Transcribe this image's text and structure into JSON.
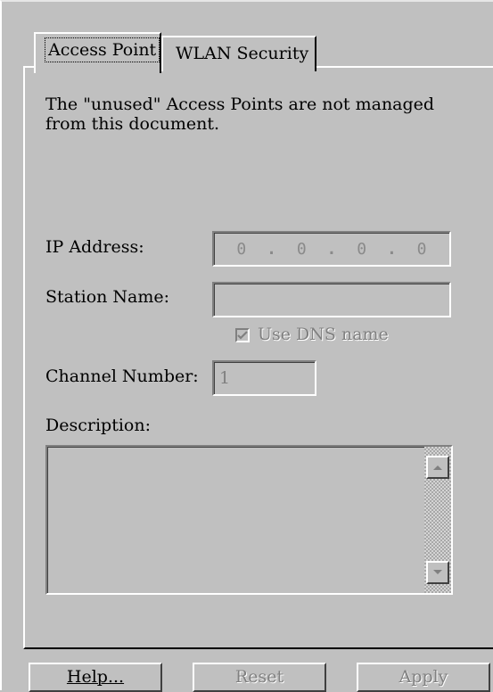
{
  "tabs": [
    {
      "label": "Access Point",
      "active": true
    },
    {
      "label": "WLAN Security",
      "active": false
    }
  ],
  "panel": {
    "note": "The \"unused\" Access Points are not managed from this document.",
    "ip_address": {
      "label": "IP Address:",
      "octets": [
        "0",
        "0",
        "0",
        "0"
      ],
      "separator": "."
    },
    "station_name": {
      "label": "Station Name:",
      "value": ""
    },
    "use_dns": {
      "label": "Use DNS name",
      "checked": true,
      "enabled": false
    },
    "channel_number": {
      "label": "Channel Number:",
      "value": "1"
    },
    "description": {
      "label": "Description:",
      "value": ""
    }
  },
  "buttons": {
    "help": "Help...",
    "reset": "Reset",
    "apply": "Apply"
  },
  "icons": {
    "scroll_up": "triangle-up-icon",
    "scroll_down": "triangle-down-icon",
    "checkmark": "checkmark-icon"
  }
}
